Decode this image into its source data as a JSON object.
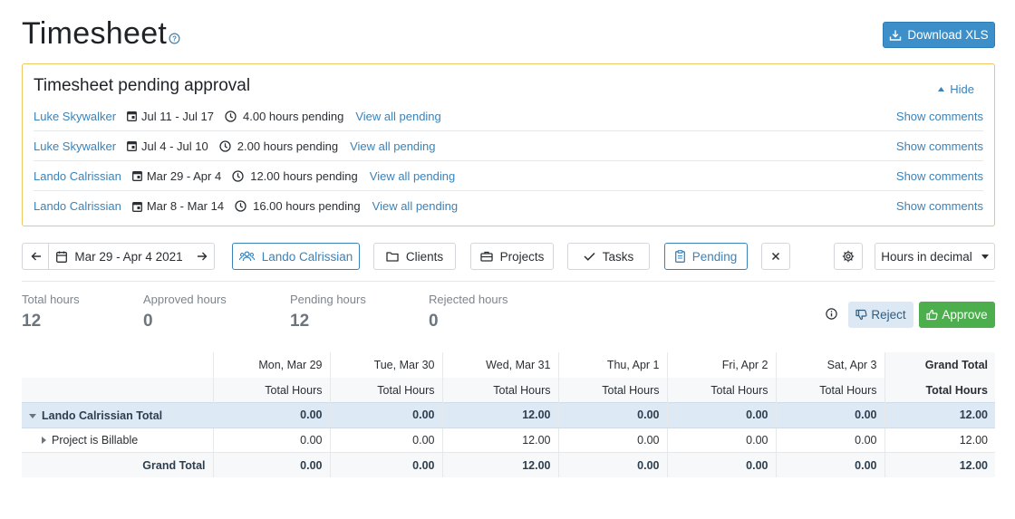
{
  "header": {
    "title": "Timesheet",
    "download_label": "Download XLS"
  },
  "pending": {
    "title": "Timesheet pending approval",
    "hide_label": "Hide",
    "rows": [
      {
        "name": "Luke Skywalker",
        "dates": "Jul 11 - Jul 17",
        "hours": "4.00 hours pending",
        "view": "View all pending",
        "comments": "Show comments"
      },
      {
        "name": "Luke Skywalker",
        "dates": "Jul 4 - Jul 10",
        "hours": "2.00 hours pending",
        "view": "View all pending",
        "comments": "Show comments"
      },
      {
        "name": "Lando Calrissian",
        "dates": "Mar 29 - Apr 4",
        "hours": "12.00 hours pending",
        "view": "View all pending",
        "comments": "Show comments"
      },
      {
        "name": "Lando Calrissian",
        "dates": "Mar 8 - Mar 14",
        "hours": "16.00 hours pending",
        "view": "View all pending",
        "comments": "Show comments"
      }
    ]
  },
  "toolbar": {
    "date_range": "Mar 29 - Apr 4 2021",
    "user_filter": "Lando Calrissian",
    "clients": "Clients",
    "projects": "Projects",
    "tasks": "Tasks",
    "pending": "Pending",
    "hours_format": "Hours in decimal"
  },
  "stats": [
    {
      "label": "Total hours",
      "value": "12"
    },
    {
      "label": "Approved hours",
      "value": "0"
    },
    {
      "label": "Pending hours",
      "value": "12"
    },
    {
      "label": "Rejected hours",
      "value": "0"
    }
  ],
  "actions": {
    "reject": "Reject",
    "approve": "Approve"
  },
  "table": {
    "days": [
      "Mon, Mar 29",
      "Tue, Mar 30",
      "Wed, Mar 31",
      "Thu, Apr 1",
      "Fri, Apr 2",
      "Sat, Apr 3"
    ],
    "grand_total_header": "Grand Total",
    "sub_header": "Total Hours",
    "rows": [
      {
        "label": "Lando Calrissian Total",
        "values": [
          "0.00",
          "0.00",
          "12.00",
          "0.00",
          "0.00",
          "0.00"
        ],
        "total": "12.00"
      },
      {
        "label": "Project is Billable",
        "values": [
          "0.00",
          "0.00",
          "12.00",
          "0.00",
          "0.00",
          "0.00"
        ],
        "total": "12.00"
      },
      {
        "label": "Grand Total",
        "values": [
          "0.00",
          "0.00",
          "12.00",
          "0.00",
          "0.00",
          "0.00"
        ],
        "total": "12.00"
      }
    ]
  },
  "colors": {
    "accent": "#3b82b8",
    "panel_border": "#f0c860",
    "approve": "#4cae4c",
    "reject_bg": "#dce9f4"
  }
}
